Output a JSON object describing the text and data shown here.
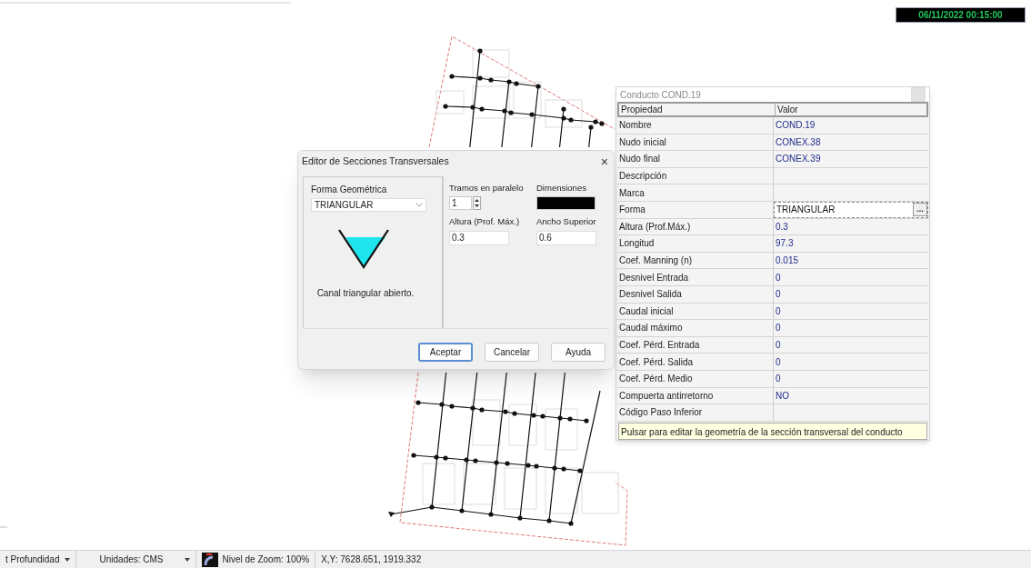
{
  "clock": "06/11/2022 00:15:00",
  "property_window": {
    "title": "Conducto COND.19",
    "columns": [
      "Propiedad",
      "Valor"
    ],
    "rows": [
      {
        "name": "Nombre",
        "value": "COND.19"
      },
      {
        "name": "Nudo inicial",
        "value": "CONEX.38"
      },
      {
        "name": "Nudo final",
        "value": "CONEX.39"
      },
      {
        "name": "Descripción"
      },
      {
        "name": "Marca"
      },
      {
        "name": "Forma",
        "value": "TRIANGULAR",
        "kind": "editor",
        "button": "..."
      },
      {
        "name": "Altura (Prof.Máx.)",
        "value": "0.3"
      },
      {
        "name": "Longitud",
        "value": "97.3"
      },
      {
        "name": "Coef. Manning (n)",
        "value": "0.015"
      },
      {
        "name": "Desnivel Entrada",
        "value": "0"
      },
      {
        "name": "Desnivel Salida",
        "value": "0"
      },
      {
        "name": "Caudal inicial",
        "value": "0"
      },
      {
        "name": "Caudal máximo",
        "value": "0"
      },
      {
        "name": "Coef. Pérd. Entrada",
        "value": "0"
      },
      {
        "name": "Coef. Pérd. Salida",
        "value": "0"
      },
      {
        "name": "Coef. Pérd. Medio",
        "value": "0"
      },
      {
        "name": "Compuerta antirretorno",
        "value": "NO"
      },
      {
        "name": "Código Paso Inferior"
      }
    ],
    "hint": "Pulsar para editar la geometría de la sección transversal del conducto"
  },
  "dialog": {
    "title": "Editor de Secciones Transversales",
    "close": "×",
    "shape_label": "Forma Geométrica",
    "shape": "TRIANGULAR",
    "description": "Canal triangular abierto.",
    "fields": [
      {
        "label": "Tramos en paralelo",
        "value": "1",
        "kind": "spinner"
      },
      {
        "label": "Dimensiones",
        "kind": "swatch"
      },
      {
        "label": "Altura (Prof. Máx.)",
        "value": "0.3",
        "kind": "text"
      },
      {
        "label": "Ancho Superior",
        "value": "0.6",
        "kind": "text"
      }
    ],
    "buttons": [
      {
        "label": "Aceptar",
        "default": true
      },
      {
        "label": "Cancelar",
        "default": false
      },
      {
        "label": "Ayuda",
        "default": false
      }
    ]
  },
  "status_bar": [
    {
      "text": "t Profundidad",
      "kind": "dropdown"
    },
    {
      "text": "Unidades: CMS",
      "kind": "dropdown"
    },
    {
      "text": "Nivel de Zoom: 100%",
      "kind": "zoom"
    },
    {
      "text": "X,Y: 7628.651, 1919.332",
      "kind": "text"
    }
  ]
}
